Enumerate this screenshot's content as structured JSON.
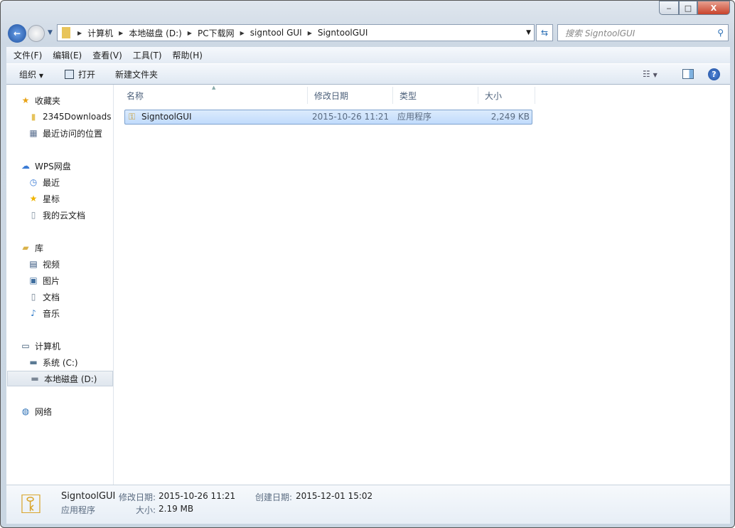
{
  "window": {
    "minimize": "‒",
    "maximize": "□",
    "close": "X"
  },
  "address": {
    "crumbs": [
      "计算机",
      "本地磁盘 (D:)",
      "PC下载网",
      "signtool GUI",
      "SigntoolGUI"
    ]
  },
  "search": {
    "placeholder": "搜索 SigntoolGUI"
  },
  "menu": [
    "文件(F)",
    "编辑(E)",
    "查看(V)",
    "工具(T)",
    "帮助(H)"
  ],
  "toolbar": {
    "organize": "组织",
    "open": "打开",
    "new_folder": "新建文件夹"
  },
  "sidebar": [
    {
      "label": "收藏夹",
      "icon": "star-icon",
      "glyph": "★",
      "color": "#e8a317",
      "indent": 0
    },
    {
      "label": "2345Downloads",
      "icon": "folder-icon",
      "glyph": "▮",
      "color": "#e6c35c",
      "indent": 1
    },
    {
      "label": "最近访问的位置",
      "icon": "recent-places-icon",
      "glyph": "▦",
      "color": "#5b7090",
      "indent": 1
    },
    {
      "label": "WPS网盘",
      "icon": "cloud-icon",
      "glyph": "☁",
      "color": "#3a7bd5",
      "indent": 0
    },
    {
      "label": "最近",
      "icon": "clock-icon",
      "glyph": "◷",
      "color": "#3a7bd5",
      "indent": 1
    },
    {
      "label": "星标",
      "icon": "star-icon",
      "glyph": "★",
      "color": "#f0b400",
      "indent": 1
    },
    {
      "label": "我的云文档",
      "icon": "document-icon",
      "glyph": "▯",
      "color": "#8090a0",
      "indent": 1
    },
    {
      "label": "库",
      "icon": "library-icon",
      "glyph": "▰",
      "color": "#d9b24a",
      "indent": 0
    },
    {
      "label": "视频",
      "icon": "video-icon",
      "glyph": "▤",
      "color": "#2d4f7a",
      "indent": 1
    },
    {
      "label": "图片",
      "icon": "picture-icon",
      "glyph": "▣",
      "color": "#3f6e9e",
      "indent": 1
    },
    {
      "label": "文档",
      "icon": "document-icon",
      "glyph": "▯",
      "color": "#6f7f90",
      "indent": 1
    },
    {
      "label": "音乐",
      "icon": "music-icon",
      "glyph": "♪",
      "color": "#2f79c8",
      "indent": 1
    },
    {
      "label": "计算机",
      "icon": "computer-icon",
      "glyph": "▭",
      "color": "#34526f",
      "indent": 0
    },
    {
      "label": "系统 (C:)",
      "icon": "system-drive-icon",
      "glyph": "▬",
      "color": "#5b7a94",
      "indent": 1
    },
    {
      "label": "本地磁盘 (D:)",
      "icon": "drive-icon",
      "glyph": "▬",
      "color": "#7c8896",
      "indent": 1,
      "selected": true
    },
    {
      "label": "网络",
      "icon": "network-icon",
      "glyph": "◍",
      "color": "#2b6fb5",
      "indent": 0
    }
  ],
  "columns": [
    "名称",
    "修改日期",
    "类型",
    "大小"
  ],
  "files": [
    {
      "name": "SigntoolGUI",
      "modified": "2015-10-26 11:21",
      "type": "应用程序",
      "size": "2,249 KB"
    }
  ],
  "details": {
    "name": "SigntoolGUI",
    "type": "应用程序",
    "modified_label": "修改日期:",
    "modified": "2015-10-26 11:21",
    "size_label": "大小:",
    "size": "2.19 MB",
    "created_label": "创建日期:",
    "created": "2015-12-01 15:02"
  }
}
